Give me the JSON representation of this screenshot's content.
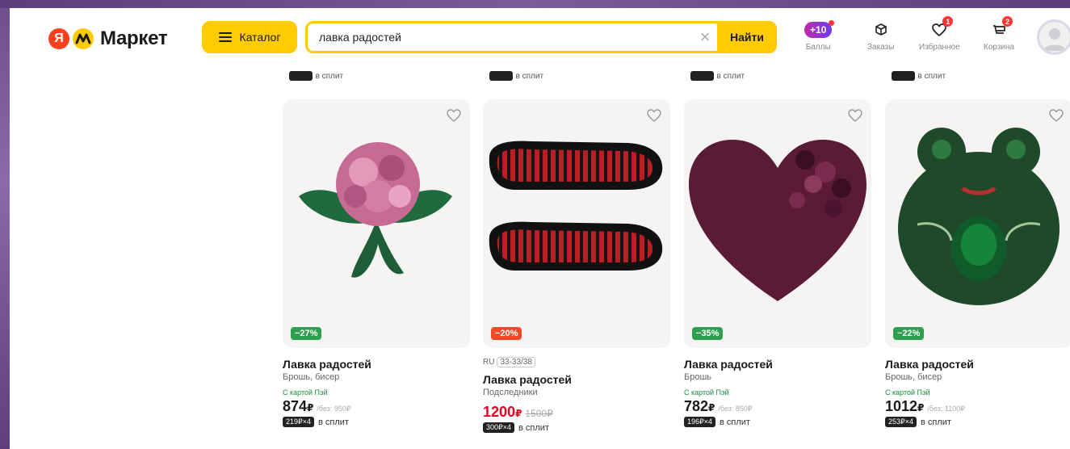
{
  "header": {
    "logo_ya": "Я",
    "logo_text": "Маркет",
    "catalog_label": "Каталог",
    "search_value": "лавка радостей",
    "search_button": "Найти",
    "nav": [
      {
        "badge": "10",
        "label": "Баллы",
        "icon": "plus-points-icon"
      },
      {
        "label": "Заказы",
        "icon": "box-icon"
      },
      {
        "label": "Избранное",
        "icon": "heart-outline-icon",
        "count": "1"
      },
      {
        "label": "Корзина",
        "icon": "cart-icon",
        "count": "2"
      }
    ]
  },
  "prev_row": {
    "split_text": "в сплит"
  },
  "products": [
    {
      "discount": "−27%",
      "discount_color": "#2e9e4f",
      "title": "Лавка радостей",
      "subtitle": "Брошь, бисер",
      "card_label": "С картой Пэй",
      "price": "874",
      "currency": "₽",
      "without": "/без: 950₽",
      "split_chip": "219₽×4",
      "split_text": "в сплит"
    },
    {
      "discount": "−20%",
      "discount_color": "#f04a2a",
      "ru_label": "RU",
      "ru_code": "33-33/38",
      "title": "Лавка радостей",
      "subtitle": "Подследники",
      "price": "1200",
      "currency": "₽",
      "old_price": "1500₽",
      "split_chip": "300₽×4",
      "split_text": "в сплит"
    },
    {
      "discount": "−35%",
      "discount_color": "#2e9e4f",
      "title": "Лавка радостей",
      "subtitle": "Брошь",
      "card_label": "С картой Пэй",
      "price": "782",
      "currency": "₽",
      "without": "/без: 850₽",
      "split_chip": "196₽×4",
      "split_text": "в сплит"
    },
    {
      "discount": "−22%",
      "discount_color": "#2e9e4f",
      "title": "Лавка радостей",
      "subtitle": "Брошь, бисер",
      "card_label": "С картой Пэй",
      "price": "1012",
      "currency": "₽",
      "without": "/без: 1100₽",
      "split_chip": "253₽×4",
      "split_text": "в сплит"
    }
  ]
}
